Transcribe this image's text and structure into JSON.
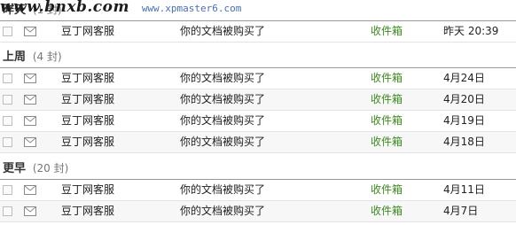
{
  "colors": {
    "folder": "#3c8a1f",
    "separator": "#999999",
    "row_alt": "#f7f7f7"
  },
  "watermark": {
    "text": "www.bnxb.com",
    "url": "www.xpmaster6.com"
  },
  "groups": [
    {
      "label": "昨天",
      "count": "(1 封)",
      "rows": [
        {
          "sender": "豆丁网客服",
          "subject": "你的文档被购买了",
          "folder": "收件箱",
          "date": "昨天 20:39"
        }
      ]
    },
    {
      "label": "上周",
      "count": "(4 封)",
      "rows": [
        {
          "sender": "豆丁网客服",
          "subject": "你的文档被购买了",
          "folder": "收件箱",
          "date": "4月24日"
        },
        {
          "sender": "豆丁网客服",
          "subject": "你的文档被购买了",
          "folder": "收件箱",
          "date": "4月20日"
        },
        {
          "sender": "豆丁网客服",
          "subject": "你的文档被购买了",
          "folder": "收件箱",
          "date": "4月19日"
        },
        {
          "sender": "豆丁网客服",
          "subject": "你的文档被购买了",
          "folder": "收件箱",
          "date": "4月18日"
        }
      ]
    },
    {
      "label": "更早",
      "count": "(20 封)",
      "rows": [
        {
          "sender": "豆丁网客服",
          "subject": "你的文档被购买了",
          "folder": "收件箱",
          "date": "4月11日"
        },
        {
          "sender": "豆丁网客服",
          "subject": "你的文档被购买了",
          "folder": "收件箱",
          "date": "4月7日"
        }
      ]
    }
  ]
}
